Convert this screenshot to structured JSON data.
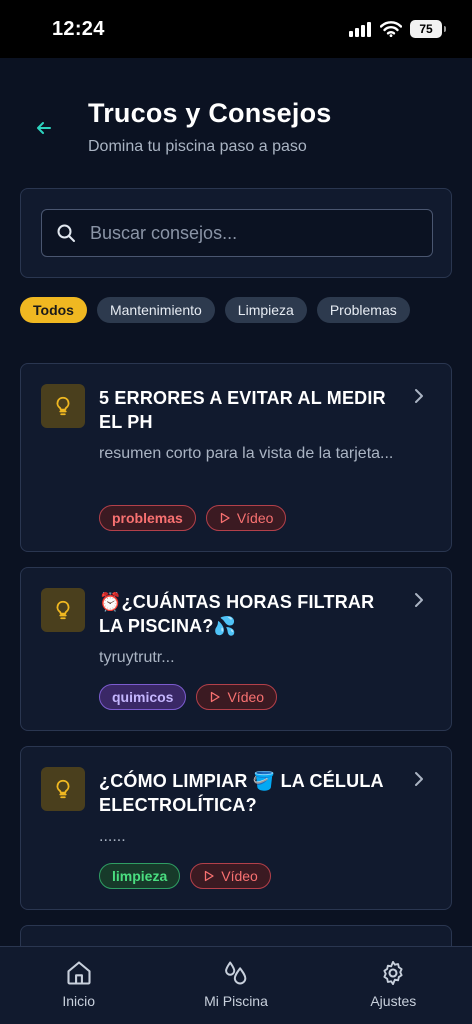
{
  "status": {
    "time": "12:24",
    "battery": "75"
  },
  "header": {
    "title": "Trucos y Consejos",
    "subtitle": "Domina tu piscina paso a paso"
  },
  "search": {
    "placeholder": "Buscar consejos..."
  },
  "filters": [
    "Todos",
    "Mantenimiento",
    "Limpieza",
    "Problemas"
  ],
  "cards": [
    {
      "title": "5 ERRORES A EVITAR AL MEDIR EL PH",
      "summary": "resumen corto para la vista de la tarjeta...",
      "tag": "problemas",
      "video": "Vídeo"
    },
    {
      "title": "⏰¿CUÁNTAS HORAS FILTRAR LA PISCINA?💦",
      "summary": "tyruytrutr...",
      "tag": "quimicos",
      "video": "Vídeo"
    },
    {
      "title": "¿CÓMO LIMPIAR 🪣 LA CÉLULA ELECTROLÍTICA?",
      "summary": "......",
      "tag": "limpieza",
      "video": "Vídeo"
    }
  ],
  "nav": {
    "home": "Inicio",
    "pool": "Mi Piscina",
    "settings": "Ajustes"
  },
  "colors": {
    "accent": "#f0b821",
    "background": "#0b1222",
    "card": "#111a2e",
    "back_arrow": "#2dd4bf"
  }
}
